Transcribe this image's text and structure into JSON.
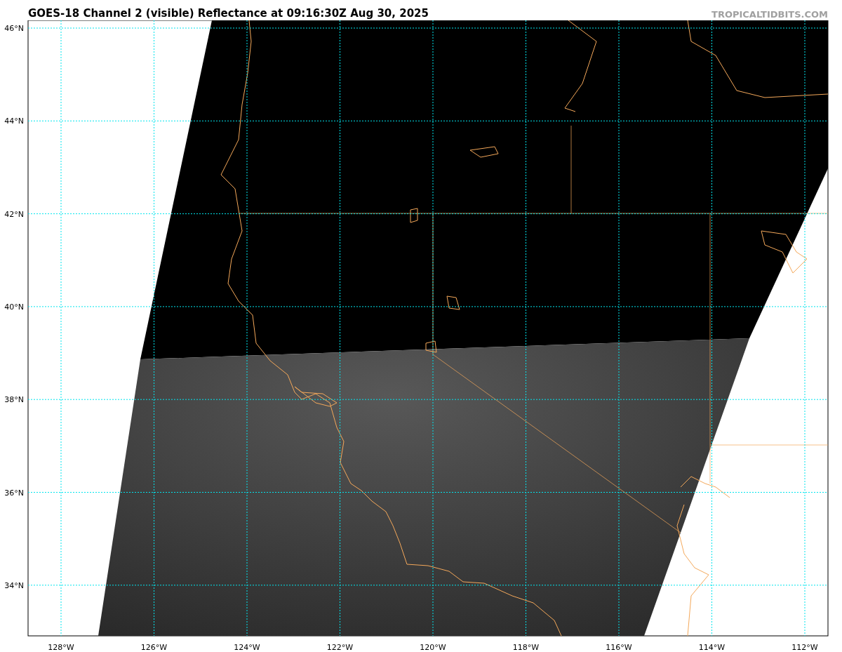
{
  "title": "GOES-18 Channel 2 (visible) Reflectance at 09:16:30Z Aug 30, 2025",
  "credit": "TROPICALTIDBITS.COM",
  "map": {
    "lat_labels": [
      "46°N",
      "44°N",
      "42°N",
      "40°N",
      "38°N",
      "36°N",
      "34°N"
    ],
    "lon_labels": [
      "128°W",
      "126°W",
      "124°W",
      "122°W",
      "120°W",
      "118°W",
      "116°W",
      "114°W",
      "112°W"
    ]
  }
}
